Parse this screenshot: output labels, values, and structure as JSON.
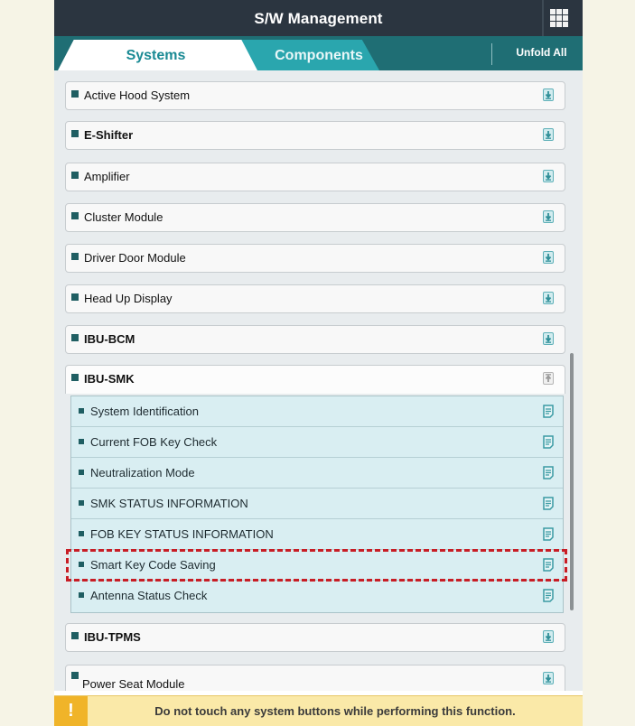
{
  "header": {
    "title": "S/W Management",
    "menu_icon": "grid-menu-icon"
  },
  "tabs": {
    "systems": "Systems",
    "components": "Components",
    "active": "Systems",
    "unfold_all": "Unfold All"
  },
  "systems": [
    {
      "label": "Active Hood System",
      "bold": false,
      "icon": "download-icon",
      "expanded": false
    },
    {
      "label": "E-Shifter",
      "bold": true,
      "icon": "download-icon",
      "expanded": false
    },
    {
      "label": "Amplifier",
      "bold": false,
      "icon": "download-icon",
      "expanded": false
    },
    {
      "label": "Cluster Module",
      "bold": false,
      "icon": "download-icon",
      "expanded": false
    },
    {
      "label": "Driver Door Module",
      "bold": false,
      "icon": "download-icon",
      "expanded": false
    },
    {
      "label": "Head Up Display",
      "bold": false,
      "icon": "download-icon",
      "expanded": false
    },
    {
      "label": "IBU-BCM",
      "bold": true,
      "icon": "download-icon",
      "expanded": false
    },
    {
      "label": "IBU-SMK",
      "bold": true,
      "icon": "upload-icon",
      "expanded": true
    },
    {
      "label": "IBU-TPMS",
      "bold": true,
      "icon": "download-icon",
      "expanded": false
    },
    {
      "label": "Power Seat Module",
      "bold": false,
      "icon": "download-icon",
      "expanded": false
    }
  ],
  "ibu_smk_functions": [
    {
      "label": "System Identification",
      "icon": "document-icon"
    },
    {
      "label": "Current FOB Key Check",
      "icon": "document-icon"
    },
    {
      "label": "Neutralization Mode",
      "icon": "document-icon"
    },
    {
      "label": "SMK STATUS INFORMATION",
      "icon": "document-icon"
    },
    {
      "label": "FOB KEY STATUS INFORMATION",
      "icon": "document-icon"
    },
    {
      "label": "Smart Key Code Saving",
      "icon": "document-icon",
      "highlighted": true
    },
    {
      "label": "Antenna Status Check",
      "icon": "document-icon"
    }
  ],
  "warning": {
    "badge": "!",
    "message": "Do not touch any system buttons while performing this function."
  },
  "colors": {
    "header_bg": "#2b3540",
    "tabbar_bg": "#1f6e74",
    "active_tab_text": "#1a8a94",
    "inactive_tab_bg": "#2aa6ae",
    "highlight_border": "#c81d25",
    "warning_bg": "#fae9a8",
    "warning_badge": "#f0b429"
  }
}
